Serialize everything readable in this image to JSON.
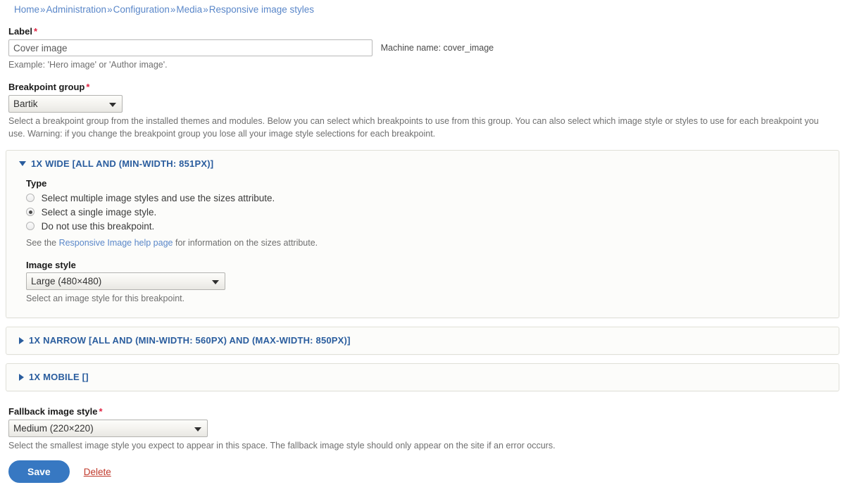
{
  "breadcrumb": {
    "separator": "»",
    "items": [
      {
        "label": "Home"
      },
      {
        "label": "Administration"
      },
      {
        "label": "Configuration"
      },
      {
        "label": "Media"
      },
      {
        "label": "Responsive image styles"
      }
    ]
  },
  "label_field": {
    "label": "Label",
    "required_mark": "*",
    "value": "Cover image",
    "placeholder": "",
    "machine_name": "Machine name: cover_image",
    "description": "Example: 'Hero image' or 'Author image'."
  },
  "breakpoint_group": {
    "label": "Breakpoint group",
    "required_mark": "*",
    "selected": "Bartik",
    "options": [
      "Bartik"
    ],
    "description": "Select a breakpoint group from the installed themes and modules. Below you can select which breakpoints to use from this group. You can also select which image style or styles to use for each breakpoint you use. Warning: if you change the breakpoint group you lose all your image style selections for each breakpoint."
  },
  "breakpoints": [
    {
      "summary": "1X WIDE [ALL AND (MIN-WIDTH: 851PX)]",
      "open": true,
      "type": {
        "label": "Type",
        "options": [
          {
            "label": "Select multiple image styles and use the sizes attribute.",
            "checked": false
          },
          {
            "label": "Select a single image style.",
            "checked": true
          },
          {
            "label": "Do not use this breakpoint.",
            "checked": false
          }
        ],
        "help_prefix": "See the ",
        "help_link": "Responsive Image help page",
        "help_suffix": " for information on the sizes attribute."
      },
      "image_style": {
        "label": "Image style",
        "selected": "Large (480×480)",
        "options": [
          "Large (480×480)"
        ],
        "description": "Select an image style for this breakpoint."
      }
    },
    {
      "summary": "1X NARROW [ALL AND (MIN-WIDTH: 560PX) AND (MAX-WIDTH: 850PX)]",
      "open": false
    },
    {
      "summary": "1X MOBILE []",
      "open": false
    }
  ],
  "fallback": {
    "label": "Fallback image style",
    "required_mark": "*",
    "selected": "Medium (220×220)",
    "options": [
      "Medium (220×220)"
    ],
    "description": "Select the smallest image style you expect to appear in this space. The fallback image style should only appear on the site if an error occurs."
  },
  "actions": {
    "save_label": "Save",
    "delete_label": "Delete"
  },
  "colors": {
    "link": "#5a87c9",
    "heading": "#2a5d9e",
    "primary_button": "#3778c2",
    "required": "#e02443",
    "delete_link": "#c0392b"
  }
}
